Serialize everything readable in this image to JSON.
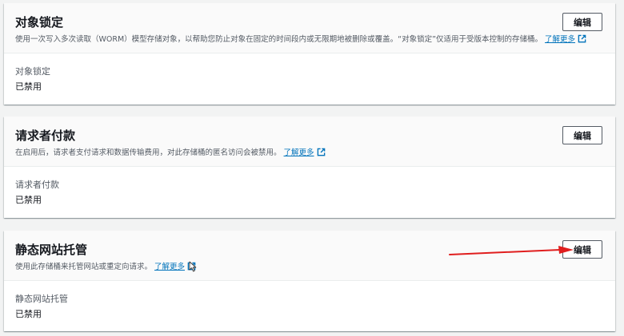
{
  "panels": [
    {
      "title": "对象锁定",
      "description": "使用一次写入多次读取（WORM）模型存储对象，以帮助您防止对象在固定的时间段内或无限期地被删除或覆盖。“对象锁定”仅适用于受版本控制的存储桶。",
      "learn_more": "了解更多",
      "edit_label": "编辑",
      "field_label": "对象锁定",
      "field_value": "已禁用"
    },
    {
      "title": "请求者付款",
      "description": "在启用后，请求者支付请求和数据传输费用，对此存储桶的匿名访问会被禁用。",
      "learn_more": "了解更多",
      "edit_label": "编辑",
      "field_label": "请求者付款",
      "field_value": "已禁用"
    },
    {
      "title": "静态网站托管",
      "description": "使用此存储桶来托管网站或重定向请求。",
      "learn_more": "了解更多",
      "edit_label": "编辑",
      "field_label": "静态网站托管",
      "field_value": "已禁用"
    }
  ],
  "colors": {
    "link": "#0073bb",
    "annotation_arrow": "#e01e1e",
    "page_background": "#f2f3f3"
  },
  "icons": {
    "external_link": "external-link-icon",
    "annotation": "red-arrow",
    "pointer": "mouse-cursor-icon"
  }
}
